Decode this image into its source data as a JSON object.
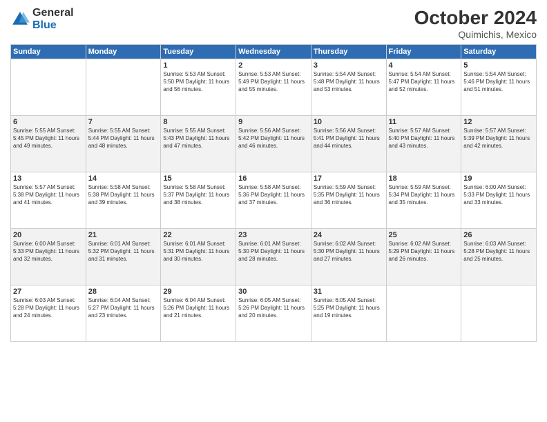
{
  "logo": {
    "general": "General",
    "blue": "Blue"
  },
  "header": {
    "month": "October 2024",
    "location": "Quimichis, Mexico"
  },
  "weekdays": [
    "Sunday",
    "Monday",
    "Tuesday",
    "Wednesday",
    "Thursday",
    "Friday",
    "Saturday"
  ],
  "weeks": [
    [
      {
        "day": "",
        "info": ""
      },
      {
        "day": "",
        "info": ""
      },
      {
        "day": "1",
        "info": "Sunrise: 5:53 AM\nSunset: 5:50 PM\nDaylight: 11 hours and 56 minutes."
      },
      {
        "day": "2",
        "info": "Sunrise: 5:53 AM\nSunset: 5:49 PM\nDaylight: 11 hours and 55 minutes."
      },
      {
        "day": "3",
        "info": "Sunrise: 5:54 AM\nSunset: 5:48 PM\nDaylight: 11 hours and 53 minutes."
      },
      {
        "day": "4",
        "info": "Sunrise: 5:54 AM\nSunset: 5:47 PM\nDaylight: 11 hours and 52 minutes."
      },
      {
        "day": "5",
        "info": "Sunrise: 5:54 AM\nSunset: 5:46 PM\nDaylight: 11 hours and 51 minutes."
      }
    ],
    [
      {
        "day": "6",
        "info": "Sunrise: 5:55 AM\nSunset: 5:45 PM\nDaylight: 11 hours and 49 minutes."
      },
      {
        "day": "7",
        "info": "Sunrise: 5:55 AM\nSunset: 5:44 PM\nDaylight: 11 hours and 48 minutes."
      },
      {
        "day": "8",
        "info": "Sunrise: 5:55 AM\nSunset: 5:43 PM\nDaylight: 11 hours and 47 minutes."
      },
      {
        "day": "9",
        "info": "Sunrise: 5:56 AM\nSunset: 5:42 PM\nDaylight: 11 hours and 46 minutes."
      },
      {
        "day": "10",
        "info": "Sunrise: 5:56 AM\nSunset: 5:41 PM\nDaylight: 11 hours and 44 minutes."
      },
      {
        "day": "11",
        "info": "Sunrise: 5:57 AM\nSunset: 5:40 PM\nDaylight: 11 hours and 43 minutes."
      },
      {
        "day": "12",
        "info": "Sunrise: 5:57 AM\nSunset: 5:39 PM\nDaylight: 11 hours and 42 minutes."
      }
    ],
    [
      {
        "day": "13",
        "info": "Sunrise: 5:57 AM\nSunset: 5:38 PM\nDaylight: 11 hours and 41 minutes."
      },
      {
        "day": "14",
        "info": "Sunrise: 5:58 AM\nSunset: 5:38 PM\nDaylight: 11 hours and 39 minutes."
      },
      {
        "day": "15",
        "info": "Sunrise: 5:58 AM\nSunset: 5:37 PM\nDaylight: 11 hours and 38 minutes."
      },
      {
        "day": "16",
        "info": "Sunrise: 5:58 AM\nSunset: 5:36 PM\nDaylight: 11 hours and 37 minutes."
      },
      {
        "day": "17",
        "info": "Sunrise: 5:59 AM\nSunset: 5:35 PM\nDaylight: 11 hours and 36 minutes."
      },
      {
        "day": "18",
        "info": "Sunrise: 5:59 AM\nSunset: 5:34 PM\nDaylight: 11 hours and 35 minutes."
      },
      {
        "day": "19",
        "info": "Sunrise: 6:00 AM\nSunset: 5:33 PM\nDaylight: 11 hours and 33 minutes."
      }
    ],
    [
      {
        "day": "20",
        "info": "Sunrise: 6:00 AM\nSunset: 5:33 PM\nDaylight: 11 hours and 32 minutes."
      },
      {
        "day": "21",
        "info": "Sunrise: 6:01 AM\nSunset: 5:32 PM\nDaylight: 11 hours and 31 minutes."
      },
      {
        "day": "22",
        "info": "Sunrise: 6:01 AM\nSunset: 5:31 PM\nDaylight: 11 hours and 30 minutes."
      },
      {
        "day": "23",
        "info": "Sunrise: 6:01 AM\nSunset: 5:30 PM\nDaylight: 11 hours and 28 minutes."
      },
      {
        "day": "24",
        "info": "Sunrise: 6:02 AM\nSunset: 5:30 PM\nDaylight: 11 hours and 27 minutes."
      },
      {
        "day": "25",
        "info": "Sunrise: 6:02 AM\nSunset: 5:29 PM\nDaylight: 11 hours and 26 minutes."
      },
      {
        "day": "26",
        "info": "Sunrise: 6:03 AM\nSunset: 5:28 PM\nDaylight: 11 hours and 25 minutes."
      }
    ],
    [
      {
        "day": "27",
        "info": "Sunrise: 6:03 AM\nSunset: 5:28 PM\nDaylight: 11 hours and 24 minutes."
      },
      {
        "day": "28",
        "info": "Sunrise: 6:04 AM\nSunset: 5:27 PM\nDaylight: 11 hours and 23 minutes."
      },
      {
        "day": "29",
        "info": "Sunrise: 6:04 AM\nSunset: 5:26 PM\nDaylight: 11 hours and 21 minutes."
      },
      {
        "day": "30",
        "info": "Sunrise: 6:05 AM\nSunset: 5:26 PM\nDaylight: 11 hours and 20 minutes."
      },
      {
        "day": "31",
        "info": "Sunrise: 6:05 AM\nSunset: 5:25 PM\nDaylight: 11 hours and 19 minutes."
      },
      {
        "day": "",
        "info": ""
      },
      {
        "day": "",
        "info": ""
      }
    ]
  ]
}
